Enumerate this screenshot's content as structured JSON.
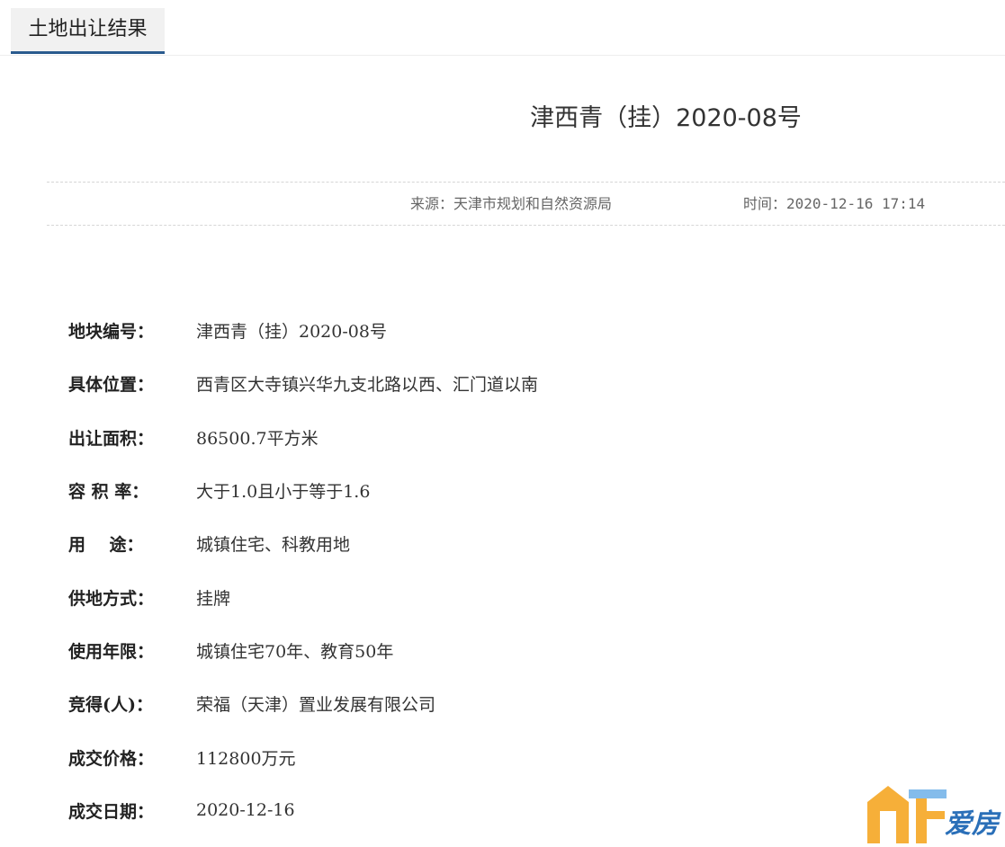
{
  "tab": {
    "label": "土地出让结果"
  },
  "article": {
    "title": "津西青（挂）2020-08号",
    "source_label": "来源：",
    "source": "天津市规划和自然资源局",
    "time_label": "时间：",
    "time": "2020-12-16 17:14"
  },
  "fields": [
    {
      "label": "地块编号：",
      "value": "津西青（挂）2020-08号"
    },
    {
      "label": "具体位置：",
      "value": "西青区大寺镇兴华九支北路以西、汇门道以南"
    },
    {
      "label": "出让面积：",
      "value": "86500.7平方米"
    },
    {
      "label": "容 积 率：",
      "value": "大于1.0且小于等于1.6"
    },
    {
      "label": "用    途：",
      "value": "城镇住宅、科教用地"
    },
    {
      "label": "供地方式：",
      "value": "挂牌"
    },
    {
      "label": "使用年限：",
      "value": "城镇住宅70年、教育50年"
    },
    {
      "label": "竞得(人)：",
      "value": "荣福（天津）置业发展有限公司"
    },
    {
      "label": "成交价格：",
      "value": "112800万元"
    },
    {
      "label": "成交日期：",
      "value": "2020-12-16"
    }
  ],
  "watermark": {
    "text": "爱房"
  },
  "colors": {
    "tab_underline": "#2a5b8e",
    "watermark_orange": "#f5a623",
    "watermark_blue": "#2a6fb8"
  }
}
